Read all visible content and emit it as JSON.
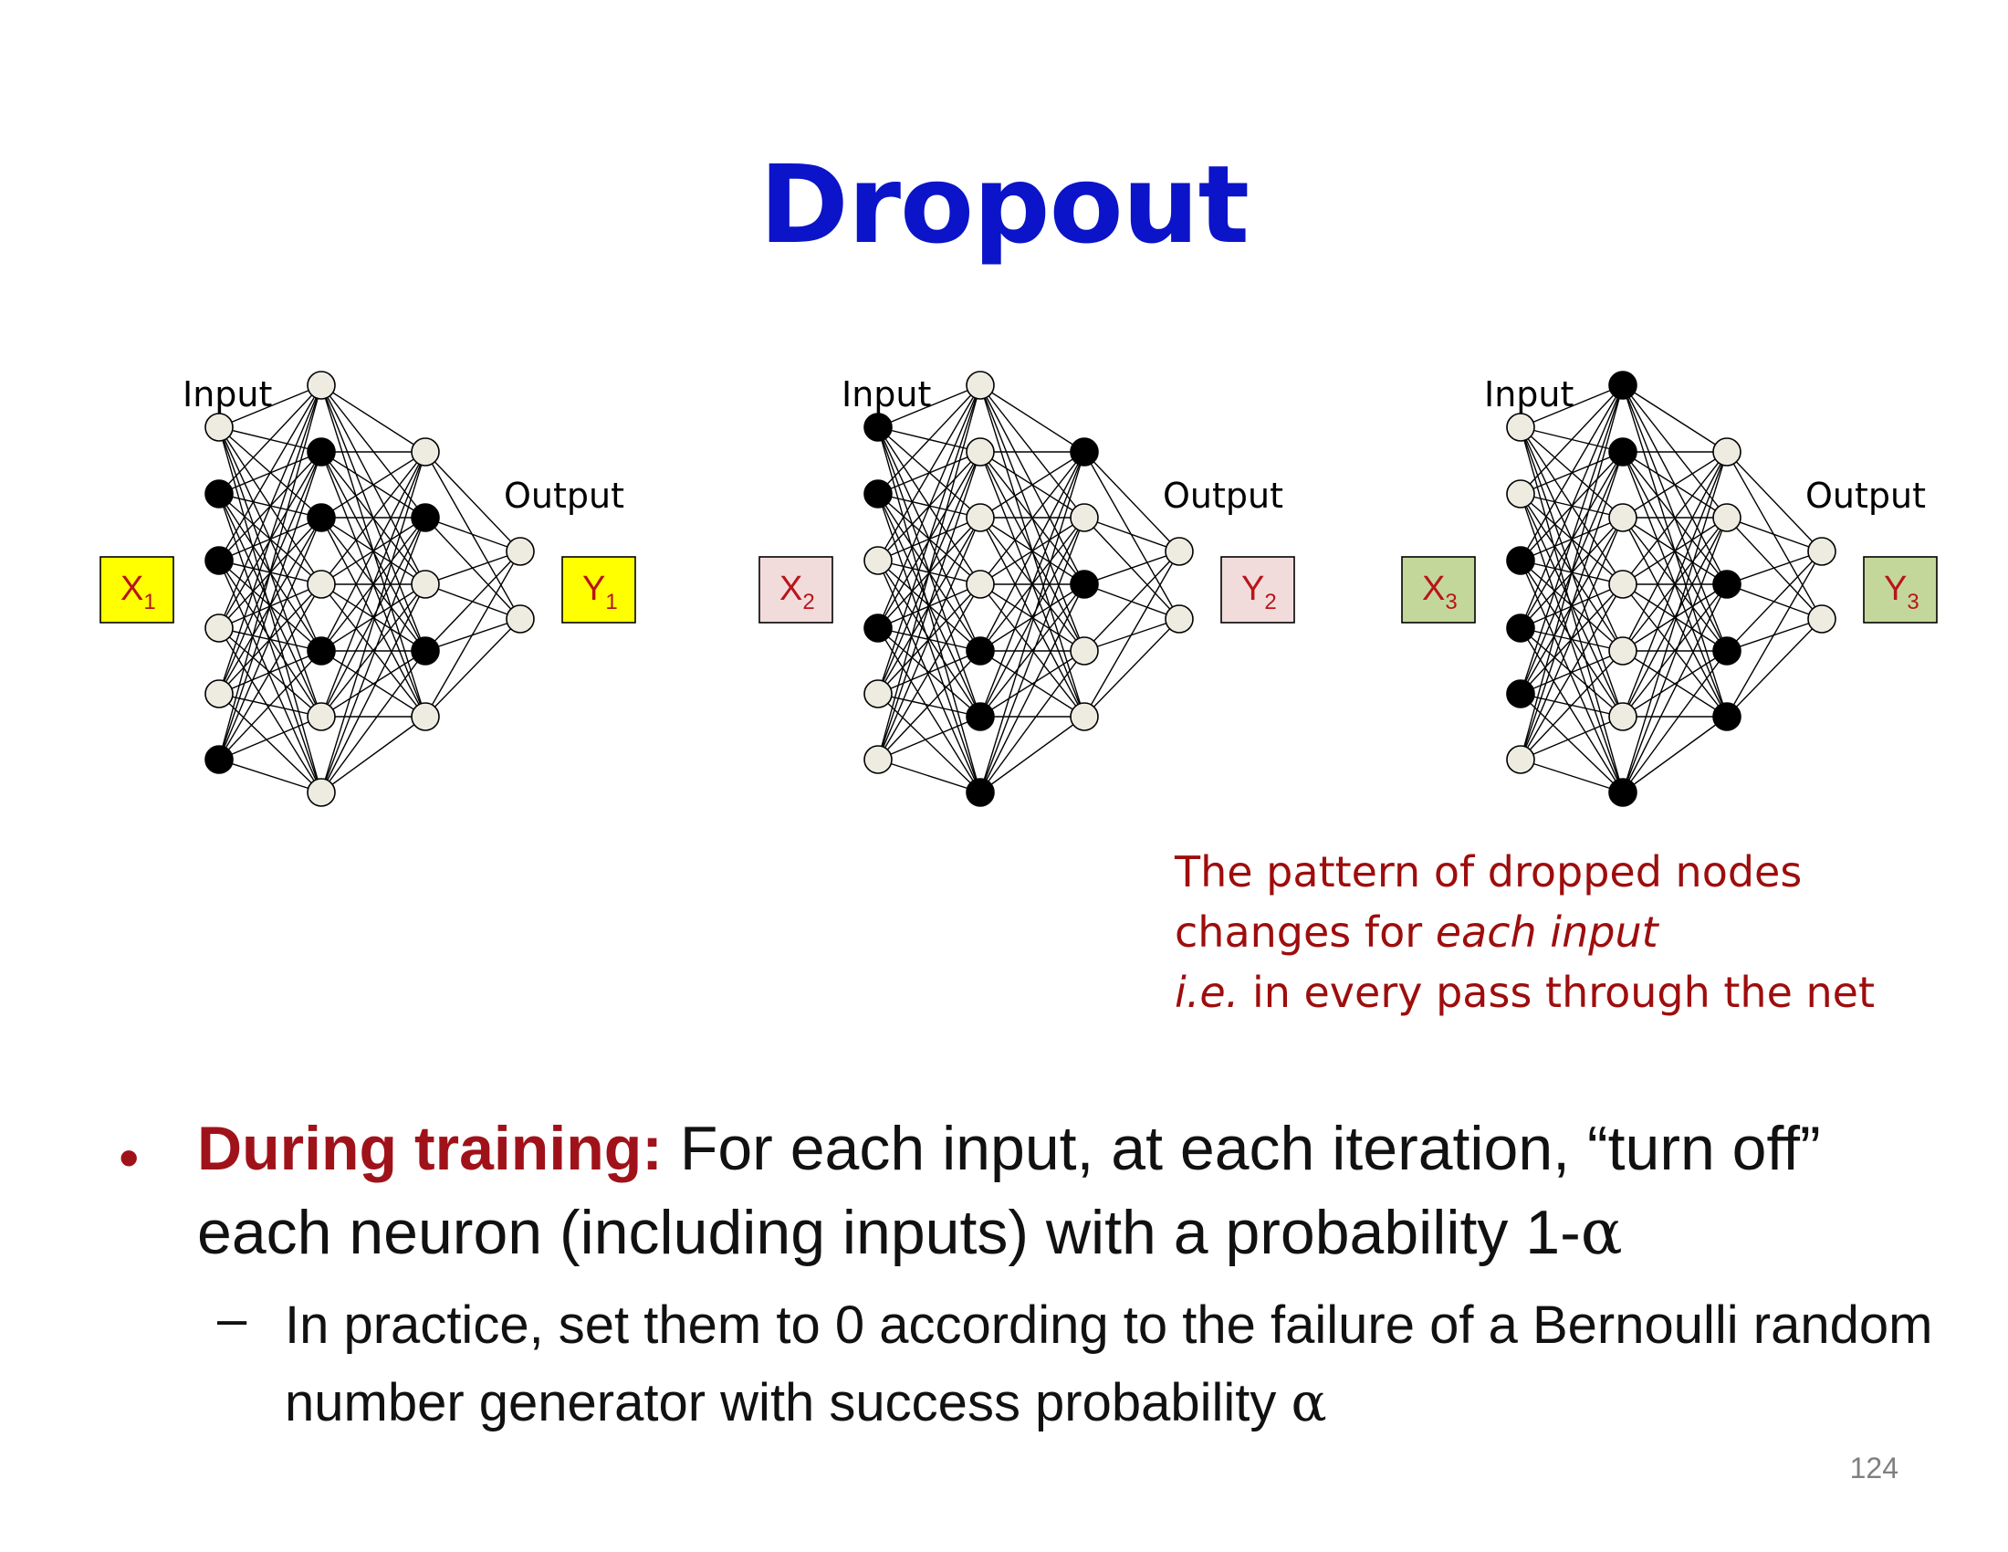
{
  "slide": {
    "title": "Dropout",
    "page_number": "124"
  },
  "networks": [
    {
      "input_label": "Input",
      "output_label": "Output",
      "x_main": "X",
      "x_sub": "1",
      "y_main": "Y",
      "y_sub": "1",
      "box_fill": "#ffff00",
      "io_text_color": "#b8151b",
      "dropped": [
        [
          false,
          true,
          true,
          false,
          false,
          true
        ],
        [
          false,
          true,
          true,
          false,
          true,
          false,
          false
        ],
        [
          false,
          true,
          false,
          true,
          false
        ],
        [
          false,
          false
        ]
      ]
    },
    {
      "input_label": "Input",
      "output_label": "Output",
      "x_main": "X",
      "x_sub": "2",
      "y_main": "Y",
      "y_sub": "2",
      "box_fill": "#f2dcdb",
      "io_text_color": "#b8151b",
      "dropped": [
        [
          true,
          true,
          false,
          true,
          false,
          false
        ],
        [
          false,
          false,
          false,
          false,
          true,
          true,
          true
        ],
        [
          true,
          false,
          true,
          false,
          false
        ],
        [
          false,
          false
        ]
      ]
    },
    {
      "input_label": "Input",
      "output_label": "Output",
      "x_main": "X",
      "x_sub": "3",
      "y_main": "Y",
      "y_sub": "3",
      "box_fill": "#c4d79b",
      "io_text_color": "#b8151b",
      "dropped": [
        [
          false,
          false,
          true,
          true,
          true,
          false
        ],
        [
          true,
          true,
          false,
          false,
          false,
          false,
          true
        ],
        [
          false,
          false,
          true,
          true,
          true
        ],
        [
          false,
          false
        ]
      ]
    }
  ],
  "node_colors": {
    "active_fill": "#eeece1",
    "dropped_fill": "#000000",
    "edge": "#000000"
  },
  "note": {
    "line1": "The pattern of dropped nodes",
    "line2_prefix": "changes for ",
    "line2_italic": "each input",
    "line3_italic": "i.e.",
    "line3_rest": " in every pass through the net"
  },
  "bullets": {
    "main_symbol": "•",
    "main_lead": "During training:",
    "main_text": " For each input, at each iteration, “turn off” each neuron (including inputs) with a probability 1-",
    "main_alpha": "α",
    "sub_symbol": "–",
    "sub_text": "In practice, set them to 0 according to the failure of a Bernoulli random number generator with success probability ",
    "sub_alpha": "α"
  }
}
